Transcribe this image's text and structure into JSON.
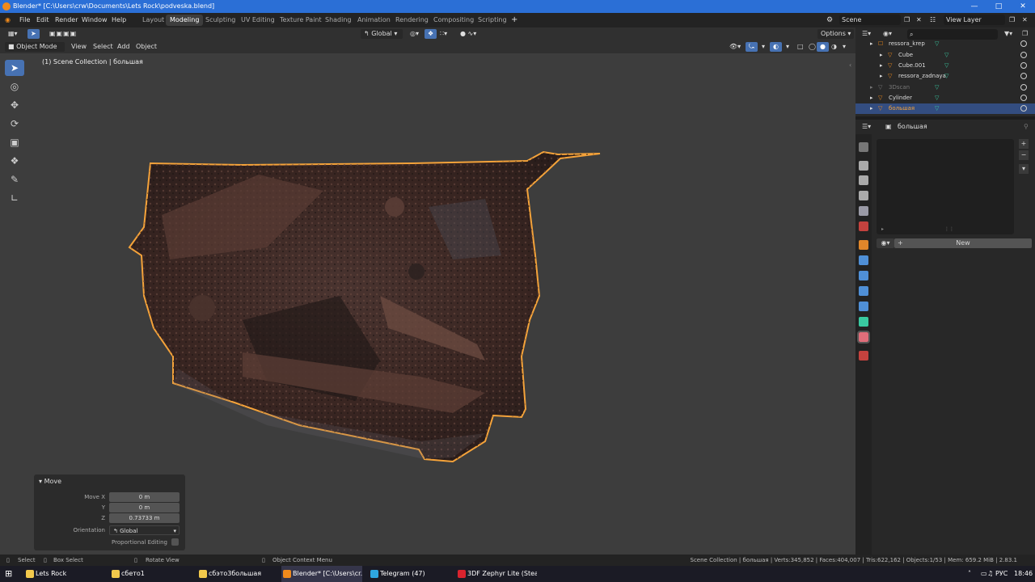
{
  "window": {
    "title": "Blender* [C:\\Users\\crw\\Documents\\Lets Rock\\podveska.blend]"
  },
  "menu": [
    "File",
    "Edit",
    "Render",
    "Window",
    "Help"
  ],
  "workspaces": [
    "Layout",
    "Modeling",
    "Sculpting",
    "UV Editing",
    "Texture Paint",
    "Shading",
    "Animation",
    "Rendering",
    "Compositing",
    "Scripting"
  ],
  "active_workspace": "Modeling",
  "scene": {
    "name": "Scene",
    "view_layer": "View Layer"
  },
  "header": {
    "orientation": "Global",
    "options": "Options"
  },
  "viewport_header": {
    "mode": "Object Mode",
    "view": "View",
    "select": "Select",
    "add": "Add",
    "object": "Object"
  },
  "viewport": {
    "info": "(1) Scene Collection | большая"
  },
  "operator_panel": {
    "title": "Move",
    "move_x_label": "Move X",
    "move_x": "0 m",
    "y_label": "Y",
    "y": "0 m",
    "z_label": "Z",
    "z": "0.73733 m",
    "orientation_label": "Orientation",
    "orientation": "Global",
    "proportional_label": "Proportional Editing"
  },
  "outliner": {
    "search_placeholder": "",
    "items": [
      {
        "name": "ressora_krep",
        "depth": 1,
        "state": "normal"
      },
      {
        "name": "Cube",
        "depth": 2,
        "state": "normal"
      },
      {
        "name": "Cube.001",
        "depth": 2,
        "state": "normal"
      },
      {
        "name": "ressora_zadnaya",
        "depth": 2,
        "state": "normal"
      },
      {
        "name": "3Dscan",
        "depth": 1,
        "state": "dim"
      },
      {
        "name": "Cylinder",
        "depth": 1,
        "state": "normal"
      },
      {
        "name": "большая",
        "depth": 1,
        "state": "selected"
      }
    ]
  },
  "properties": {
    "object_name": "большая",
    "new_button": "New"
  },
  "statusbar": {
    "select": "Select",
    "box_select": "Box Select",
    "rotate_view": "Rotate View",
    "context_menu": "Object Context Menu",
    "stats": "Scene Collection | большая | Verts:345,852 | Faces:404,007 | Tris:622,162 | Objects:1/53 | Mem: 659.2 MiB | 2.83.1"
  },
  "taskbar": {
    "items": [
      {
        "label": "Lets Rock",
        "color": "#f2c94c"
      },
      {
        "label": "сбето1",
        "color": "#f2c94c"
      },
      {
        "label": "сбэто3большая",
        "color": "#f2c94c"
      },
      {
        "label": "Blender* [C:\\Users\\cr...",
        "color": "#f08a1c"
      },
      {
        "label": "Telegram (47)",
        "color": "#2ea6e0"
      },
      {
        "label": "3DF Zephyr Lite (Stea...",
        "color": "#d9232e"
      }
    ],
    "lang": "РУС",
    "time": "18:46"
  },
  "colors": {
    "accent": "#4772b3",
    "selection_outline": "#f5a33a",
    "titlebar": "#2b6fd6"
  }
}
